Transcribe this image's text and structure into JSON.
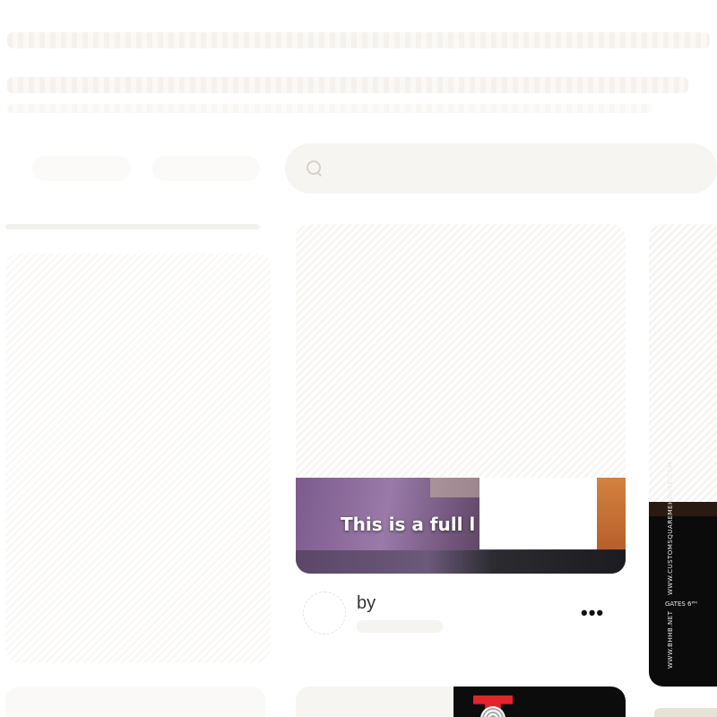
{
  "toolbar": {
    "chip_1": "",
    "chip_2": "",
    "search_placeholder": ""
  },
  "feed": {
    "main_pin": {
      "caption": "This is a full l",
      "author_prefix": "",
      "author_by": "by",
      "more_label": "•••"
    },
    "right_pin": {
      "vertical_text_1": "WWW.CUSTOMSQUAREMEHOUSE.COM",
      "gates_text": "GATES 6ᴾᴹ",
      "vertical_text_2": "WWW.BHHB.NET"
    }
  }
}
